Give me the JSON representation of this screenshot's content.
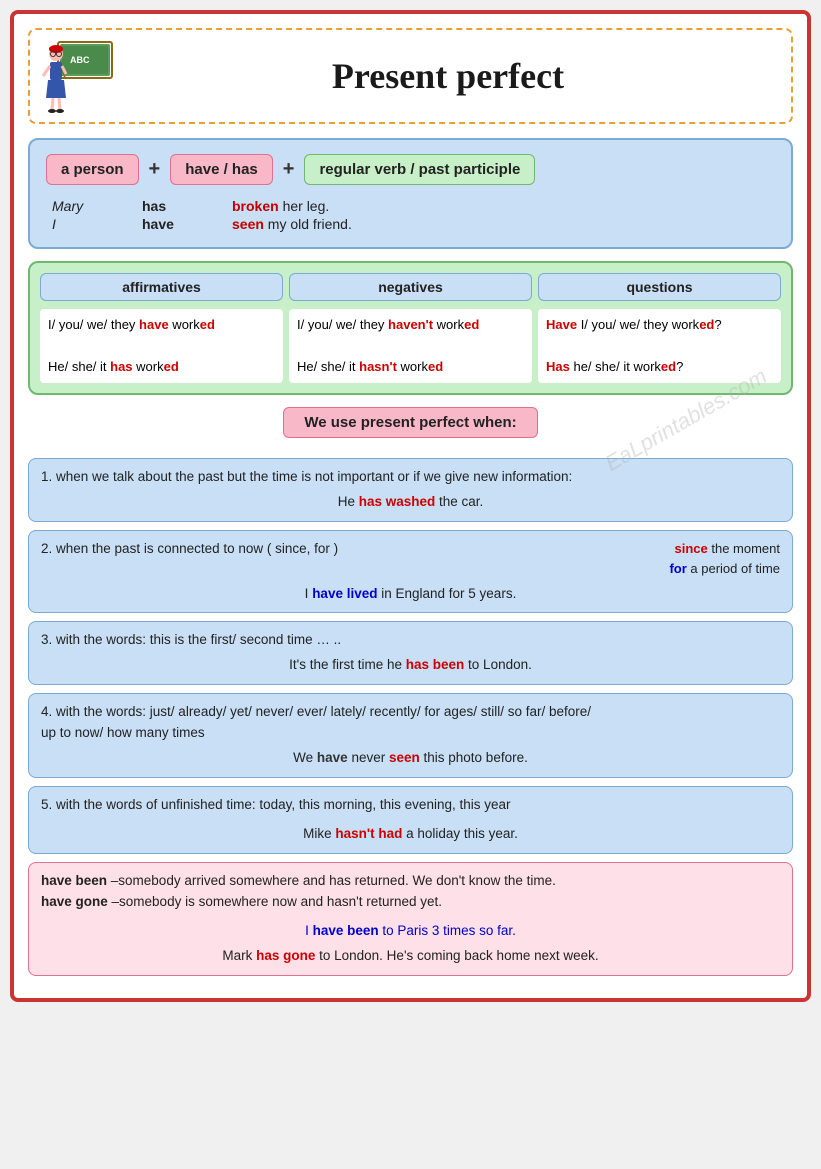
{
  "header": {
    "title": "Present perfect"
  },
  "formula": {
    "pill1": "a person",
    "pill2": "have / has",
    "pill3": "regular verb / past participle",
    "plus": "+",
    "examples": [
      {
        "person": "Mary",
        "aux": "has",
        "verb": "broken",
        "rest": " her leg."
      },
      {
        "person": "I",
        "aux": "have",
        "verb": "seen",
        "rest": " my old friend."
      }
    ]
  },
  "table": {
    "headers": [
      "affirmatives",
      "negatives",
      "questions"
    ],
    "rows": [
      {
        "affirmative": "I/ you/ we/ they have worked",
        "negative": "I/ you/ we/ they haven't worked",
        "question": "Have I/ you/ we/ they worked?"
      },
      {
        "affirmative": "He/ she/ it has worked",
        "negative": "He/ she/ it hasn't worked",
        "question": "Has he/ she/ it worked?"
      }
    ]
  },
  "usage_title": "We use present perfect when:",
  "usage_items": [
    {
      "id": 1,
      "text": "1. when we talk about the past but the time is not important or if we give new information:",
      "example": "He has washed the car."
    },
    {
      "id": 2,
      "text": "2. when the past is connected to now  ( since, for )",
      "example": "I have lived in England for 5 years.",
      "since_label": "since",
      "since_desc": "the moment",
      "for_label": "for",
      "for_desc": "a period of time"
    },
    {
      "id": 3,
      "text": "3. with the words: this is the first/ second time … ..",
      "example": "It's the first time he has been to London."
    },
    {
      "id": 4,
      "text": "4. with the words: just/ already/ yet/ never/ ever/ lately/ recently/ for ages/ still/ so far/ before/ up to now/ how many times",
      "example": "We have never seen this photo before."
    },
    {
      "id": 5,
      "text": "5. with the words of unfinished time: today, this morning, this evening, this year",
      "example": "Mike hasn't had a holiday this year."
    },
    {
      "id": 6,
      "text_line1": "6. have been –somebody arrived somewhere and has returned. We don't know the time.",
      "text_line2": "have gone –somebody is somewhere now and hasn't returned yet.",
      "example1": "I have been to Paris 3 times so far.",
      "example2": "Mark has gone to London. He's coming back home next week."
    }
  ],
  "watermark": "EaLprintables.com"
}
